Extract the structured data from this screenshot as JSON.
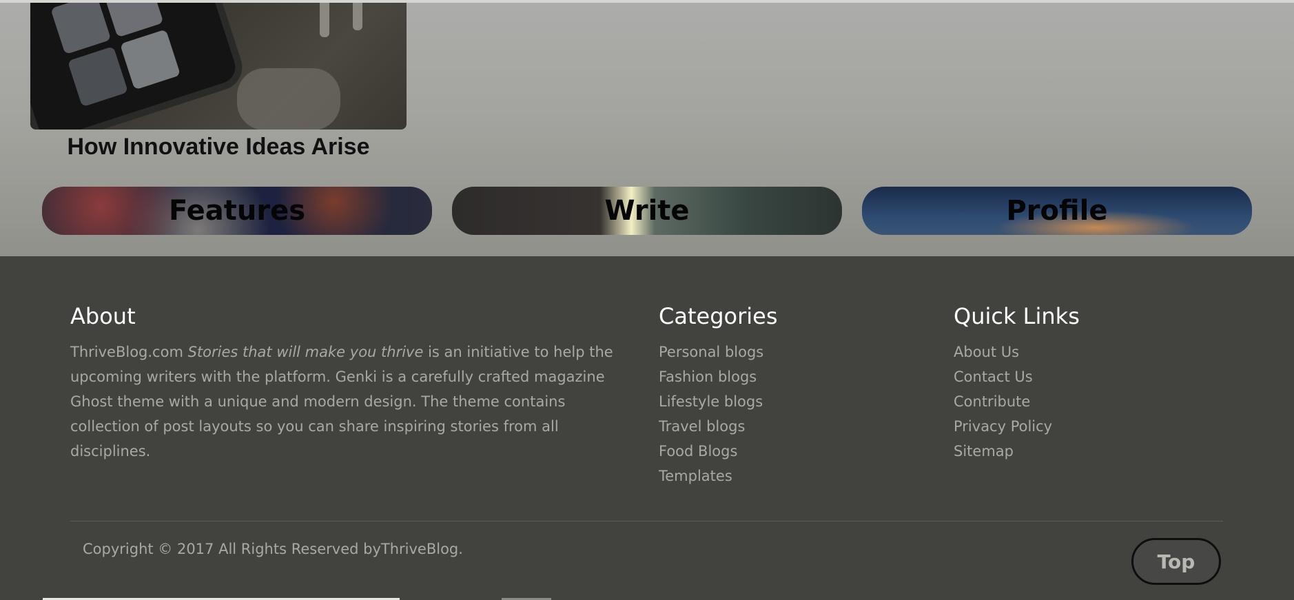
{
  "article": {
    "title": "How Innovative Ideas Arise"
  },
  "nav_buttons": [
    {
      "label": "Features"
    },
    {
      "label": "Write"
    },
    {
      "label": "Profile"
    }
  ],
  "footer": {
    "about": {
      "heading": "About",
      "site": "ThriveBlog.com",
      "tagline": "Stories that will make you thrive",
      "text": "is an initiative to help the upcoming writers with the platform. Genki is a carefully crafted magazine Ghost theme with a unique and modern design. The theme contains collection of post layouts so you can share inspiring stories from all disciplines."
    },
    "categories": {
      "heading": "Categories",
      "items": [
        "Personal blogs",
        "Fashion blogs",
        "Lifestyle blogs",
        "Travel blogs",
        "Food Blogs",
        "Templates"
      ]
    },
    "quick_links": {
      "heading": "Quick Links",
      "items": [
        "About Us",
        "Contact Us",
        "Contribute",
        "Privacy Policy",
        "Sitemap"
      ]
    },
    "copyright": "Copyright © 2017 All Rights Reserved byThriveBlog.",
    "top_button": "Top"
  }
}
